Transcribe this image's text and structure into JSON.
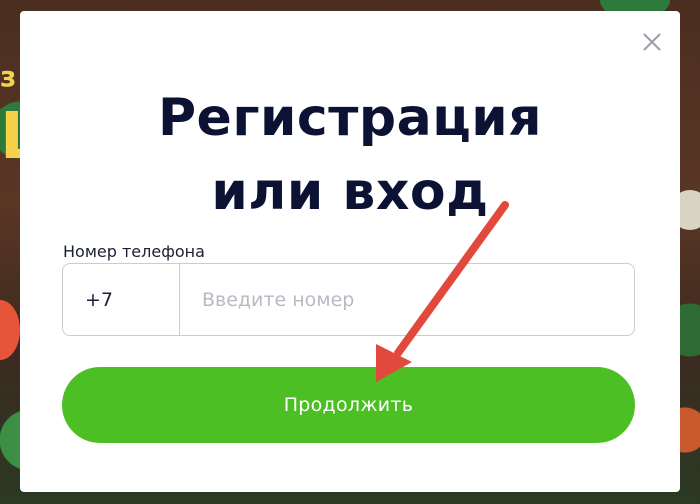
{
  "modal": {
    "title_line1": "Регистрация",
    "title_line2": "или вход",
    "close_icon": "close-icon"
  },
  "form": {
    "phone_label": "Номер телефона",
    "country_code": "+7",
    "phone_value": "",
    "phone_placeholder": "Введите номер",
    "continue_label": "Продолжить"
  },
  "colors": {
    "title": "#0c1233",
    "button": "#4cbf24",
    "arrow": "#e0493c"
  },
  "annotation": {
    "arrow_icon": "arrow-pointer"
  }
}
